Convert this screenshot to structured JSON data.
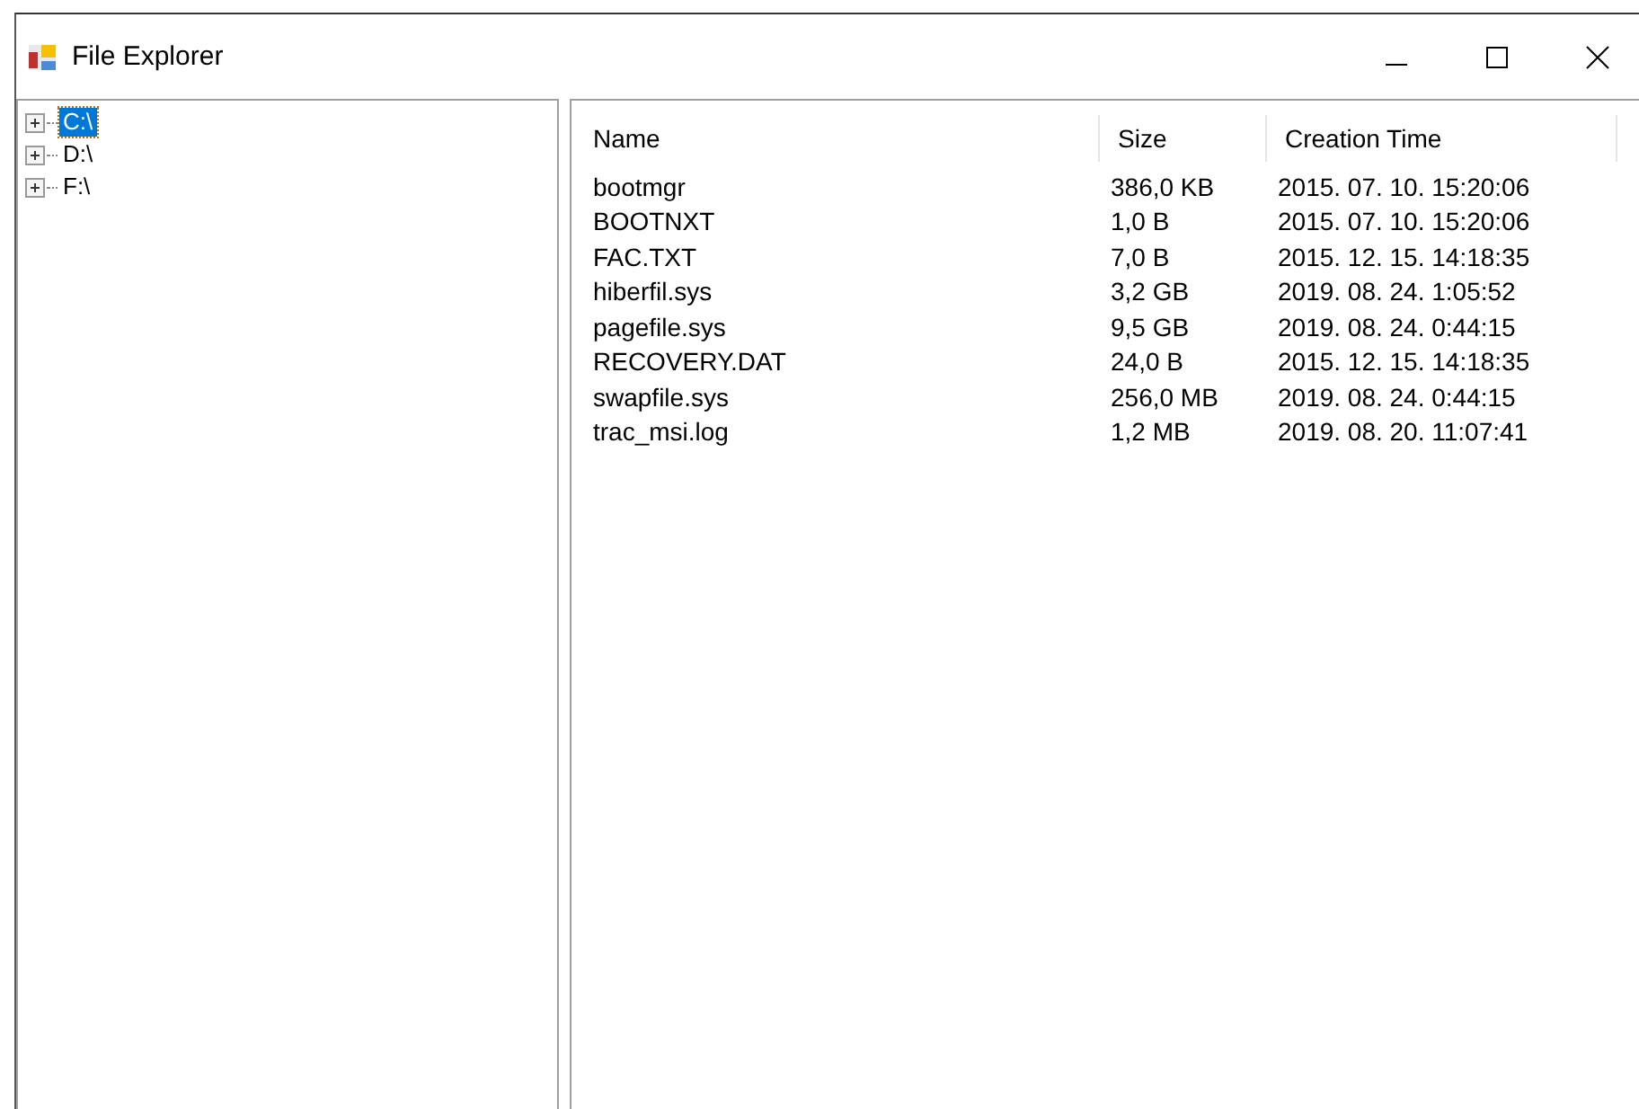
{
  "window": {
    "title": "File Explorer"
  },
  "tree": {
    "items": [
      {
        "label": "C:\\",
        "selected": true,
        "expanded": false
      },
      {
        "label": "D:\\",
        "selected": false,
        "expanded": false
      },
      {
        "label": "F:\\",
        "selected": false,
        "expanded": false
      }
    ]
  },
  "table": {
    "columns": [
      "Name",
      "Size",
      "Creation Time"
    ],
    "rows": [
      [
        "bootmgr",
        "386,0 KB",
        "2015. 07. 10. 15:20:06"
      ],
      [
        "BOOTNXT",
        "1,0 B",
        "2015. 07. 10. 15:20:06"
      ],
      [
        "FAC.TXT",
        "7,0 B",
        "2015. 12. 15. 14:18:35"
      ],
      [
        "hiberfil.sys",
        "3,2 GB",
        "2019. 08. 24. 1:05:52"
      ],
      [
        "pagefile.sys",
        "9,5 GB",
        "2019. 08. 24. 0:44:15"
      ],
      [
        "RECOVERY.DAT",
        "24,0 B",
        "2015. 12. 15. 14:18:35"
      ],
      [
        "swapfile.sys",
        "256,0 MB",
        "2019. 08. 24. 0:44:15"
      ],
      [
        "trac_msi.log",
        "1,2 MB",
        "2019. 08. 20. 11:07:41"
      ]
    ]
  }
}
